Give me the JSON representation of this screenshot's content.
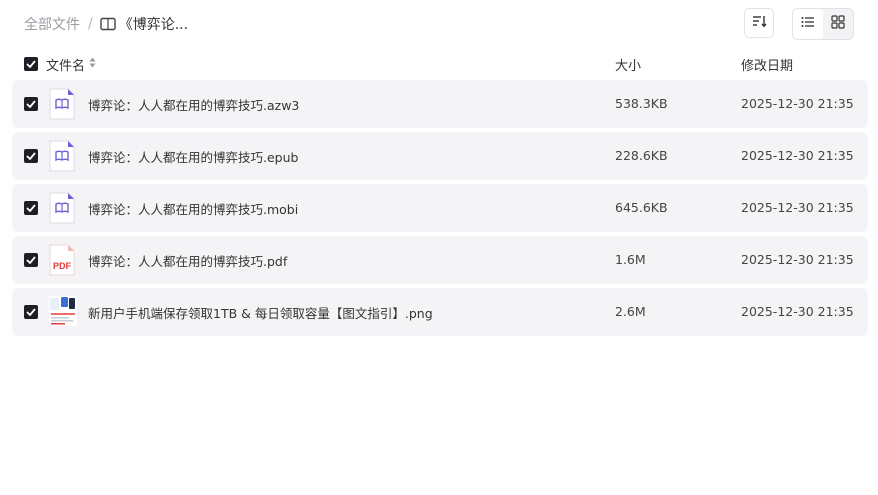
{
  "breadcrumb": {
    "root": "全部文件",
    "separator": "/",
    "current": "《博弈论..."
  },
  "toolbar": {
    "sort_icon": "sort-desc-icon",
    "view_list_icon": "list-view-icon",
    "view_grid_icon": "grid-view-icon"
  },
  "table": {
    "headers": {
      "name": "文件名",
      "size": "大小",
      "date": "修改日期"
    },
    "rows": [
      {
        "name": "博弈论：人人都在用的博弈技巧.azw3",
        "size": "538.3KB",
        "date": "2025-12-30 21:35",
        "icon": "ebook-icon"
      },
      {
        "name": "博弈论：人人都在用的博弈技巧.epub",
        "size": "228.6KB",
        "date": "2025-12-30 21:35",
        "icon": "ebook-icon"
      },
      {
        "name": "博弈论：人人都在用的博弈技巧.mobi",
        "size": "645.6KB",
        "date": "2025-12-30 21:35",
        "icon": "ebook-icon"
      },
      {
        "name": "博弈论：人人都在用的博弈技巧.pdf",
        "size": "1.6M",
        "date": "2025-12-30 21:35",
        "icon": "pdf-icon",
        "icon_label": "PDF"
      },
      {
        "name": "新用户手机端保存领取1TB & 每日领取容量【图文指引】.png",
        "size": "2.6M",
        "date": "2025-12-30 21:35",
        "icon": "image-thumbnail"
      }
    ]
  },
  "colors": {
    "row_bg": "#f4f4f6",
    "checkbox": "#1d1f24",
    "ebook_accent": "#6b63d8",
    "pdf_red": "#e23b3b"
  }
}
